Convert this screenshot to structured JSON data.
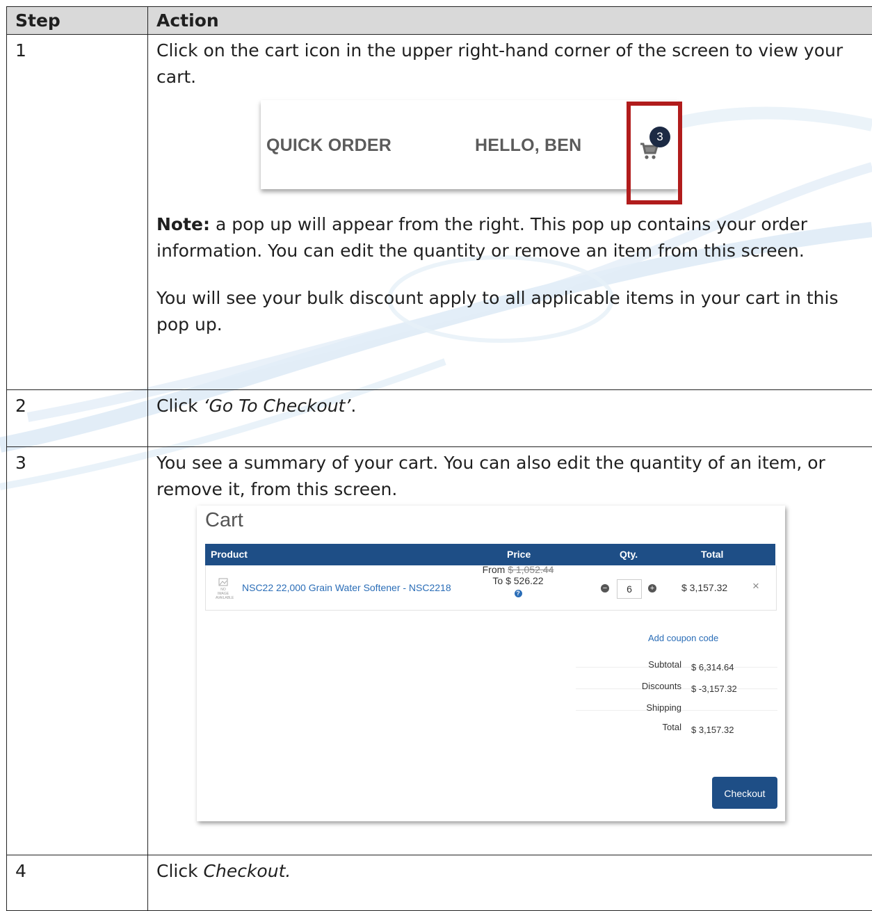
{
  "table": {
    "header_step": "Step",
    "header_action": "Action"
  },
  "rows": [
    {
      "step": "1",
      "text": "Click on the cart icon in the upper right-hand corner of the screen to view your cart.",
      "note_label": "Note:",
      "note_text": " a pop up will appear from the right. This pop up contains your order information. You can edit the quantity or remove an item from this screen.",
      "extra_text": "You will see your bulk discount apply to all applicable items in your cart in this pop up."
    },
    {
      "step": "2",
      "text_prefix": "Click ",
      "text_italic": "‘Go To Checkout’",
      "text_suffix": "."
    },
    {
      "step": "3",
      "text": "You see a summary of your cart. You can also edit the quantity of an item, or remove it, from this screen."
    },
    {
      "step": "4",
      "text_prefix": "Click ",
      "text_italic": "Checkout."
    }
  ],
  "nav_screenshot": {
    "quick_order": "QUICK ORDER",
    "greeting": "HELLO, BEN",
    "cart_count": "3",
    "cart_icon": "shopping-cart-icon",
    "highlight_color": "#b11c1c"
  },
  "cart_screenshot": {
    "title": "Cart",
    "columns": {
      "product": "Product",
      "price": "Price",
      "qty": "Qty.",
      "total": "Total"
    },
    "item": {
      "image_placeholder": "NO IMAGE AVAILABLE",
      "name": "NSC22 22,000 Grain Water Softener - NSC2218",
      "from_label": "From ",
      "from_price": "$ 1,052.44",
      "to_label": "To $ 526.22",
      "quantity": "6",
      "total": "$ 3,157.32",
      "remove_symbol": "×"
    },
    "coupon_link": "Add coupon code",
    "summary": [
      {
        "label": "Subtotal",
        "value": "$ 6,314.64"
      },
      {
        "label": "Discounts",
        "value": "$ -3,157.32"
      },
      {
        "label": "Shipping",
        "value": ""
      },
      {
        "label": "Total",
        "value": "$ 3,157.32"
      }
    ],
    "checkout_label": "Checkout",
    "accent_color": "#1e4e86"
  }
}
